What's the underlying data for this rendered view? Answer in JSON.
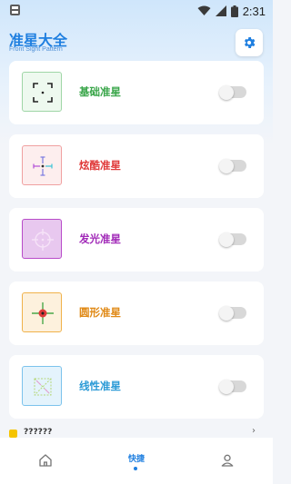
{
  "status_bar": {
    "time": "2:31",
    "icons": [
      "app-notification-icon",
      "wifi-icon",
      "signal-icon",
      "battery-icon"
    ]
  },
  "header": {
    "title": "准星大全",
    "subtitle": "Front Sight Pattern",
    "settings_icon": "gear-icon"
  },
  "crosshairs": [
    {
      "label": "基础准星",
      "color": "#3aa64a",
      "enabled": false
    },
    {
      "label": "炫酷准星",
      "color": "#e03a3a",
      "enabled": false
    },
    {
      "label": "发光准星",
      "color": "#a12ab8",
      "enabled": false
    },
    {
      "label": "圆形准星",
      "color": "#e08a17",
      "enabled": false
    },
    {
      "label": "线性准星",
      "color": "#2b9ad6",
      "enabled": false
    }
  ],
  "partial_item": {
    "label": "??????"
  },
  "bottom_nav": {
    "items": [
      {
        "icon": "home-icon",
        "label": "",
        "active": false
      },
      {
        "icon": "",
        "label": "快捷",
        "active": true
      },
      {
        "icon": "user-icon",
        "label": "",
        "active": false
      }
    ]
  },
  "colors": {
    "accent": "#1f7fe0",
    "toggle_off": "#d8d8d8"
  }
}
